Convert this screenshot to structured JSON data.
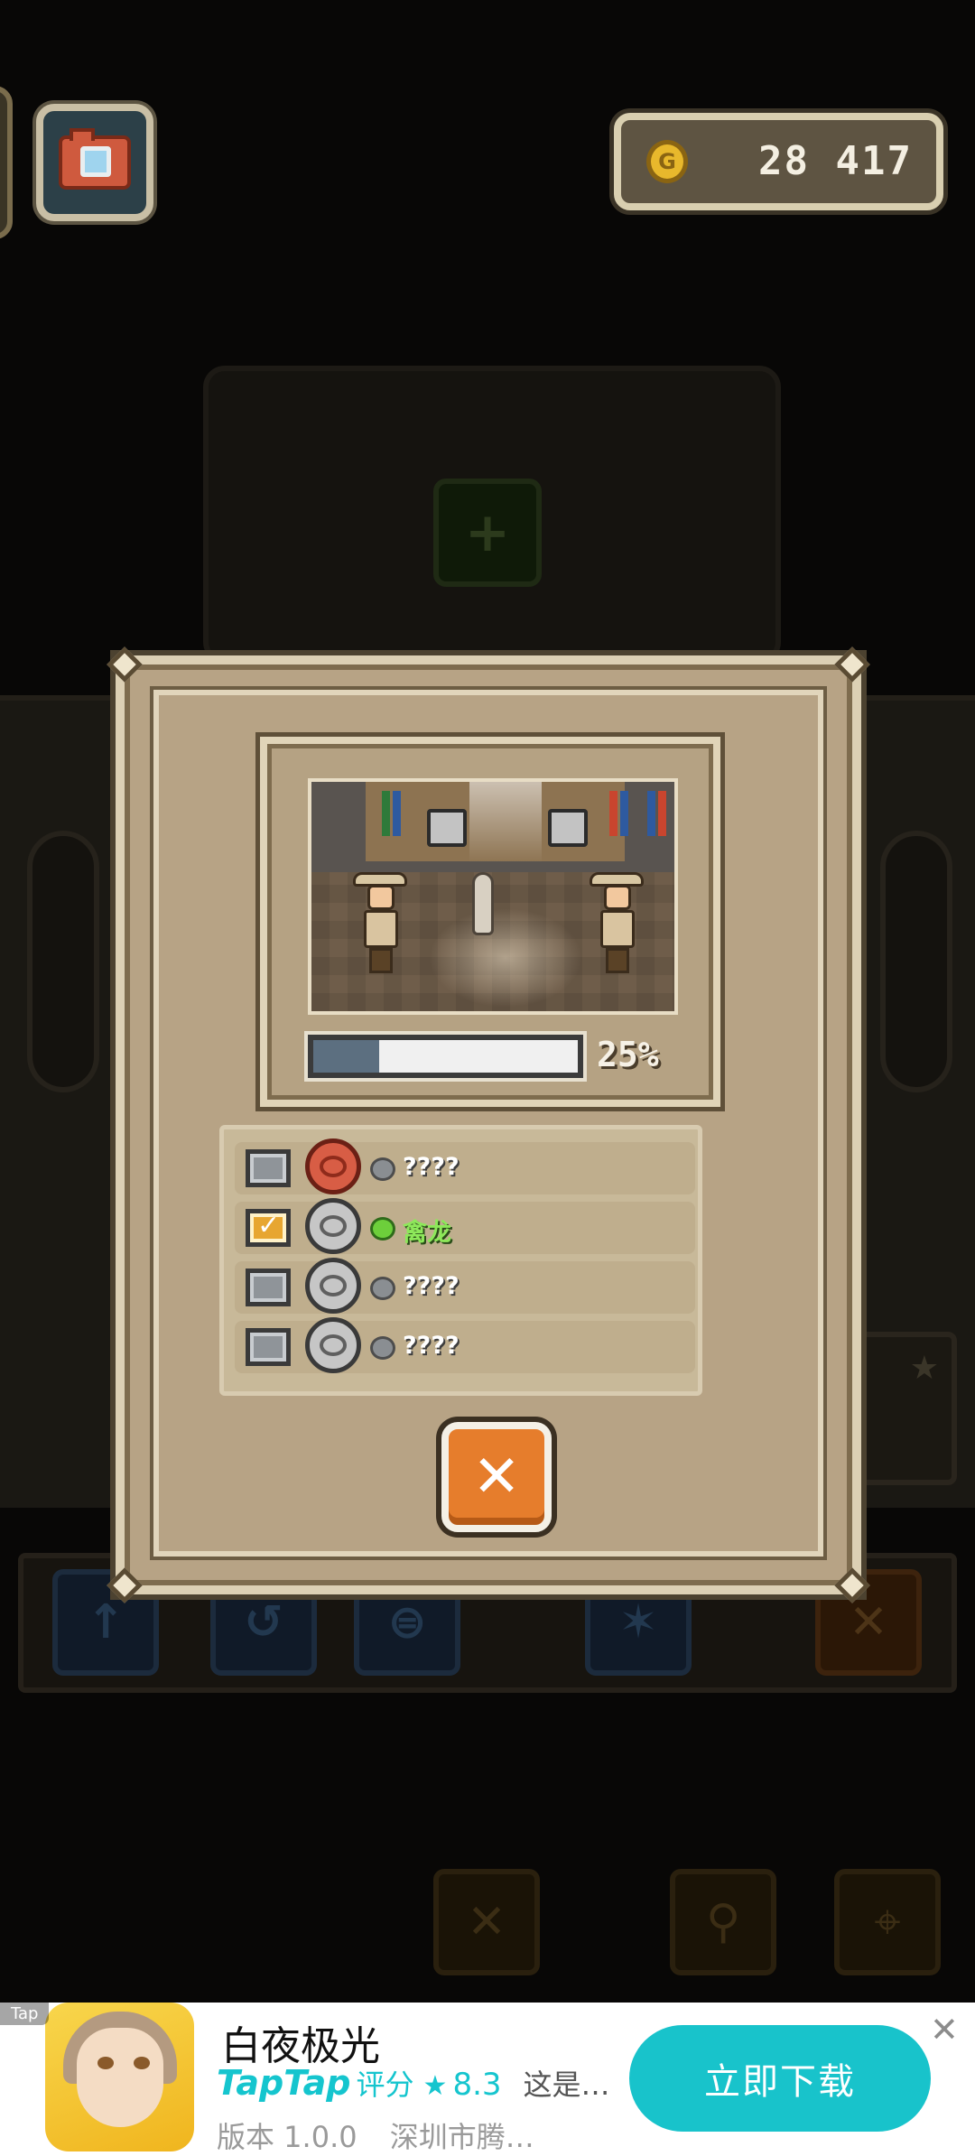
{
  "top_bar": {
    "camera_icon": "camera-icon",
    "coin_icon": "coin-icon",
    "coin_symbol": "G",
    "coins": "28 417"
  },
  "background": {
    "plus_symbol": "+",
    "star_symbol": "★",
    "tools": [
      "↑",
      "↺",
      "⊜",
      "✶",
      "✕"
    ],
    "bottom_buttons": [
      "✕",
      "⚲",
      "⌖"
    ]
  },
  "modal": {
    "progress": {
      "value": 0.25,
      "label": "25%"
    },
    "list": [
      {
        "checked": false,
        "egg": "red",
        "dot": "gray",
        "label": "????"
      },
      {
        "checked": true,
        "egg": "gray",
        "dot": "green",
        "label": "禽龙"
      },
      {
        "checked": false,
        "egg": "gray",
        "dot": "gray",
        "label": "????"
      },
      {
        "checked": false,
        "egg": "gray",
        "dot": "gray",
        "label": "????"
      }
    ],
    "close_symbol": "✕",
    "colors": {
      "accent_orange": "#e67d2c",
      "found_green": "#8de85a",
      "frame": "#b7a385"
    }
  },
  "ad": {
    "tag": "Tap",
    "title": "白夜极光",
    "platform": "TapTap",
    "rating_label": "评分",
    "star": "★",
    "rating": "8.3",
    "desc": "这是…",
    "version": "版本 1.0.0",
    "publisher": "深圳市腾…",
    "cta": "立即下载",
    "close": "✕",
    "accent": "#18c3cb"
  }
}
